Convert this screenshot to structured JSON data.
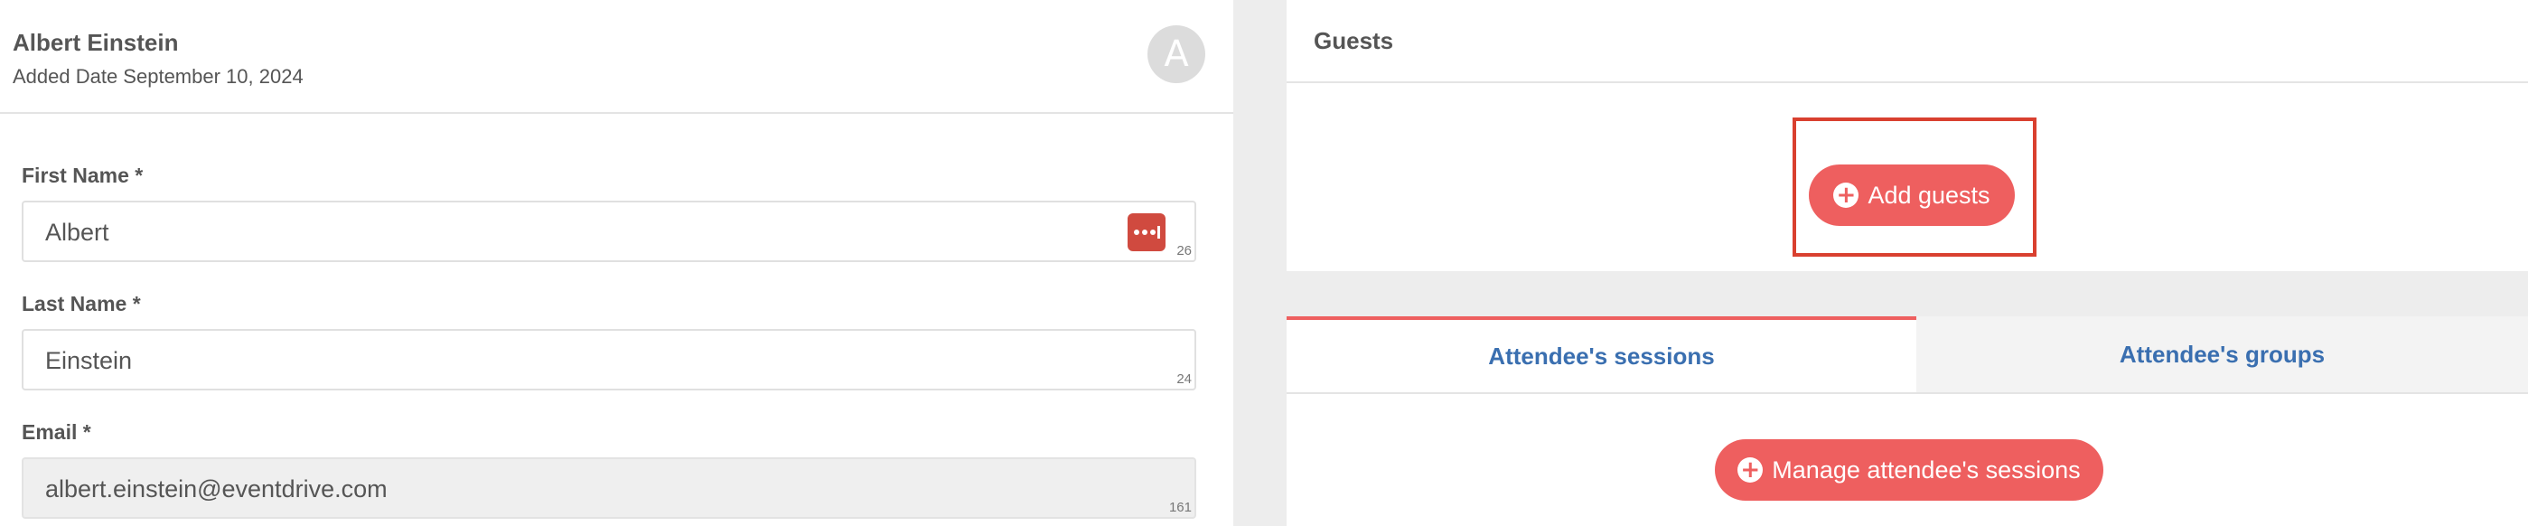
{
  "person": {
    "name": "Albert Einstein",
    "added_date": "Added Date September 10, 2024",
    "avatar_initial": "A"
  },
  "form": {
    "first_name": {
      "label": "First Name *",
      "value": "Albert",
      "count": "26"
    },
    "last_name": {
      "label": "Last Name *",
      "value": "Einstein",
      "count": "24"
    },
    "email": {
      "label": "Email *",
      "value": "albert.einstein@eventdrive.com",
      "count": "161"
    }
  },
  "guests": {
    "title": "Guests",
    "add_label": "Add guests"
  },
  "tabs": [
    {
      "label": "Attendee's sessions",
      "active": true
    },
    {
      "label": "Attendee's groups",
      "active": false
    }
  ],
  "sessions": {
    "manage_label": "Manage attendee's sessions"
  },
  "colors": {
    "accent": "#ee5f5f",
    "highlight": "#d9402f",
    "tab_text": "#3a6fb0"
  }
}
